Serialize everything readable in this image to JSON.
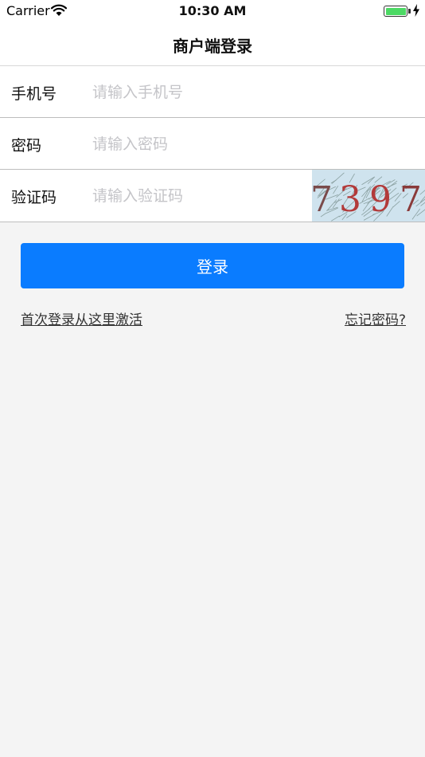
{
  "status_bar": {
    "carrier": "Carrier",
    "time": "10:30 AM",
    "wifi_icon": "wifi-icon",
    "battery_icon": "battery-icon",
    "charging_icon": "charging-bolt-icon",
    "battery_level": 1.0,
    "battery_color": "#4cd964"
  },
  "nav": {
    "title": "商户端登录"
  },
  "form": {
    "phone": {
      "label": "手机号",
      "value": "",
      "placeholder": "请输入手机号"
    },
    "password": {
      "label": "密码",
      "value": "",
      "placeholder": "请输入密码"
    },
    "captcha": {
      "label": "验证码",
      "value": "",
      "placeholder": "请输入验证码",
      "code": "7397"
    }
  },
  "actions": {
    "login_label": "登录",
    "activate_link": "首次登录从这里激活",
    "forgot_link": "忘记密码?"
  },
  "colors": {
    "accent": "#0a7cff",
    "background": "#f4f4f4",
    "placeholder": "#c4c4c8"
  }
}
